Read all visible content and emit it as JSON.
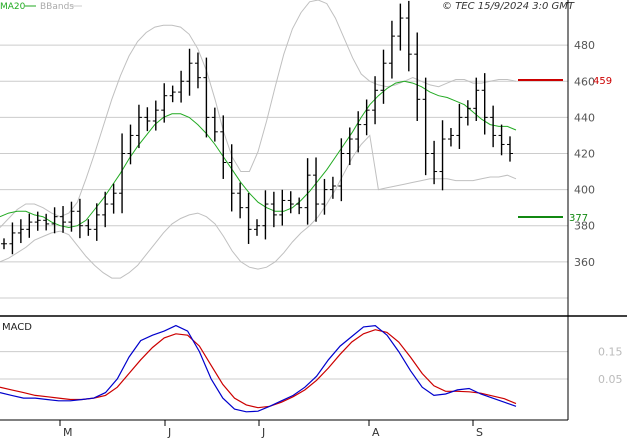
{
  "header": {
    "text": "© TEC 15/9/2024 3:0 GMT"
  },
  "legend": {
    "ma_label": "MA20",
    "bands_label": "BBands"
  },
  "macd_panel": {
    "title": "MACD",
    "y_ticks": [
      "0.15",
      "0.05"
    ]
  },
  "months": [
    "M",
    "J",
    "J",
    "A",
    "S"
  ],
  "levels": {
    "resistance": "459",
    "support": "377"
  },
  "colors": {
    "ma": "#22aa22",
    "bands": "#c0c0c0",
    "price_bars": "#000000",
    "resistance": "#cc0000",
    "support": "#118811",
    "macd_line": "#0000cc",
    "signal_line": "#cc0000",
    "grid": "#cccccc"
  },
  "chart_data": [
    {
      "type": "line",
      "panel": "price",
      "ylim": [
        330,
        505
      ],
      "y_ticks": [
        360,
        380,
        400,
        420,
        440,
        460,
        480
      ],
      "grid": true,
      "legend_position": "top-left",
      "series": [
        {
          "name": "MA20",
          "values": [
            385,
            387,
            388,
            388,
            386,
            385,
            382,
            380,
            379,
            380,
            383,
            389,
            395,
            402,
            409,
            417,
            424,
            430,
            436,
            440,
            442,
            442,
            440,
            436,
            431,
            425,
            418,
            411,
            404,
            398,
            393,
            390,
            388,
            388,
            390,
            394,
            399,
            405,
            411,
            418,
            425,
            432,
            440,
            447,
            452,
            456,
            459,
            460,
            459,
            457,
            454,
            452,
            451,
            449,
            447,
            443,
            439,
            436,
            435,
            435,
            433
          ]
        },
        {
          "name": "BBands upper",
          "values": [
            379,
            384,
            389,
            392,
            392,
            390,
            387,
            385,
            387,
            393,
            406,
            420,
            435,
            450,
            463,
            474,
            482,
            487,
            490,
            491,
            491,
            490,
            486,
            478,
            466,
            450,
            432,
            418,
            410,
            410,
            421,
            438,
            457,
            475,
            489,
            498,
            504,
            505,
            503,
            495,
            484,
            473,
            464,
            460,
            458,
            457,
            458,
            460,
            462,
            460,
            458,
            457,
            459,
            461,
            461,
            459,
            459,
            460,
            461,
            461,
            460
          ]
        },
        {
          "name": "BBands lower",
          "values": [
            360,
            362,
            365,
            368,
            372,
            374,
            376,
            377,
            375,
            369,
            363,
            358,
            354,
            351,
            351,
            354,
            358,
            364,
            370,
            376,
            381,
            384,
            386,
            387,
            385,
            381,
            374,
            366,
            360,
            357,
            356,
            357,
            360,
            365,
            371,
            376,
            380,
            385,
            392,
            400,
            409,
            418,
            425,
            430,
            400,
            401,
            402,
            403,
            404,
            405,
            406,
            406,
            406,
            405,
            405,
            405,
            406,
            407,
            407,
            408,
            406
          ]
        },
        {
          "name": "Price",
          "values": [
            370,
            376,
            378,
            382,
            383,
            381,
            385,
            382,
            388,
            380,
            378,
            386,
            392,
            398,
            420,
            430,
            440,
            438,
            444,
            452,
            454,
            460,
            470,
            462,
            440,
            432,
            415,
            398,
            390,
            378,
            380,
            392,
            386,
            394,
            392,
            390,
            408,
            392,
            400,
            402,
            420,
            428,
            436,
            444,
            455,
            470,
            485,
            495,
            475,
            450,
            420,
            410,
            428,
            430,
            440,
            445,
            455,
            440,
            430,
            425,
            420
          ]
        }
      ]
    },
    {
      "type": "line",
      "panel": "MACD",
      "title": "MACD",
      "ylim": [
        -0.1,
        0.28
      ],
      "y_ticks": [
        0.05,
        0.15
      ],
      "series": [
        {
          "name": "MACD",
          "values": [
            0.0,
            -0.01,
            -0.02,
            -0.02,
            -0.025,
            -0.03,
            -0.03,
            -0.025,
            -0.02,
            0.0,
            0.05,
            0.13,
            0.19,
            0.21,
            0.225,
            0.245,
            0.225,
            0.15,
            0.05,
            -0.02,
            -0.06,
            -0.07,
            -0.068,
            -0.05,
            -0.03,
            -0.01,
            0.02,
            0.06,
            0.12,
            0.17,
            0.205,
            0.24,
            0.245,
            0.21,
            0.15,
            0.08,
            0.02,
            -0.01,
            -0.005,
            0.01,
            0.015,
            -0.005,
            -0.02,
            -0.035,
            -0.05
          ]
        },
        {
          "name": "Signal",
          "values": [
            0.02,
            0.01,
            0.0,
            -0.01,
            -0.015,
            -0.02,
            -0.025,
            -0.025,
            -0.02,
            -0.01,
            0.02,
            0.07,
            0.12,
            0.165,
            0.2,
            0.215,
            0.21,
            0.17,
            0.1,
            0.03,
            -0.02,
            -0.045,
            -0.055,
            -0.05,
            -0.035,
            -0.015,
            0.01,
            0.045,
            0.09,
            0.14,
            0.185,
            0.215,
            0.23,
            0.22,
            0.185,
            0.13,
            0.07,
            0.025,
            0.005,
            0.005,
            0.003,
            -0.002,
            -0.012,
            -0.022,
            -0.04
          ]
        }
      ]
    }
  ]
}
